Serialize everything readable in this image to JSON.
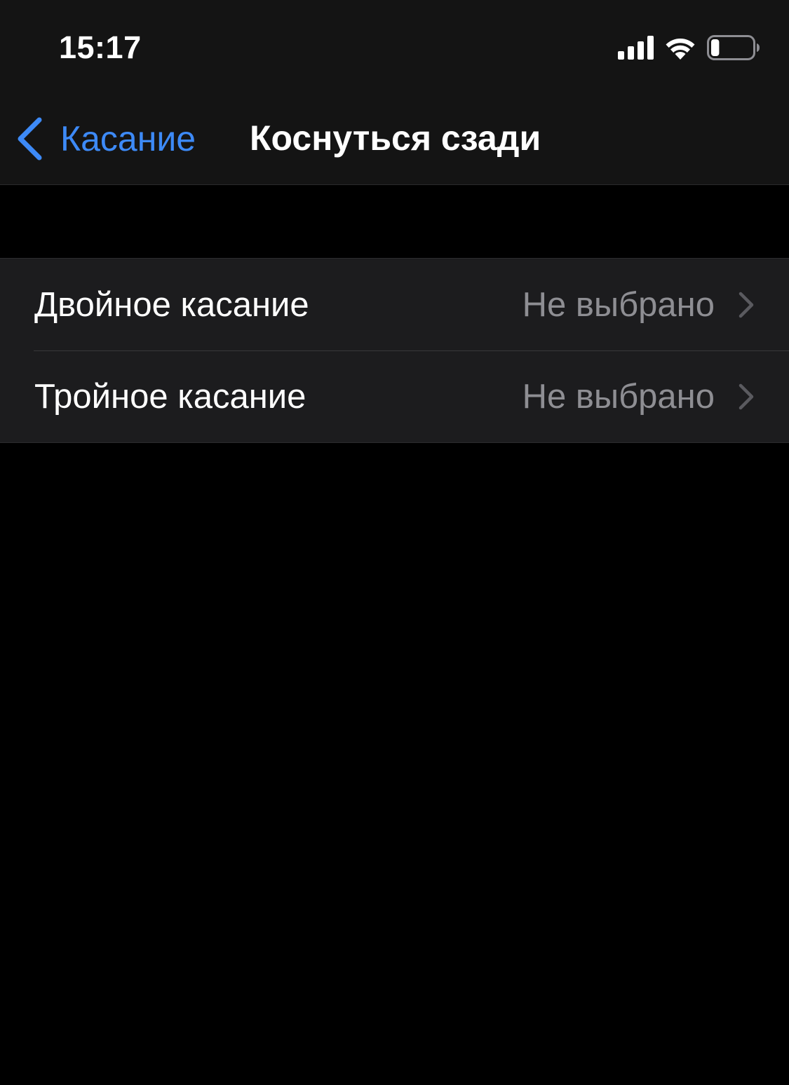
{
  "status_bar": {
    "time": "15:17",
    "battery_level_percent": 20
  },
  "nav": {
    "back_label": "Касание",
    "title": "Коснуться сзади"
  },
  "settings": {
    "rows": [
      {
        "label": "Двойное касание",
        "value": "Не выбрано"
      },
      {
        "label": "Тройное касание",
        "value": "Не выбрано"
      }
    ]
  },
  "colors": {
    "accent": "#3d8af7",
    "background": "#000000",
    "cell_background": "#1c1c1e",
    "secondary_text": "#8e8e93"
  },
  "icons": {
    "signal": "cellular-signal-icon",
    "wifi": "wifi-icon",
    "battery": "battery-icon",
    "back": "chevron-left-icon",
    "disclosure": "chevron-right-icon"
  }
}
